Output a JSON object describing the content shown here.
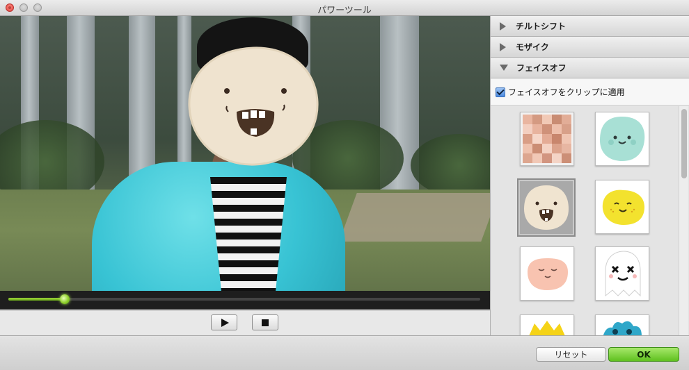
{
  "window": {
    "title": "パワーツール"
  },
  "player": {
    "progress_percent": 12
  },
  "panel": {
    "sections": [
      {
        "label": "チルトシフト",
        "expanded": false
      },
      {
        "label": "モザイク",
        "expanded": false
      },
      {
        "label": "フェイスオフ",
        "expanded": true
      }
    ],
    "faceoff": {
      "apply_label": "フェイスオフをクリップに適用",
      "apply_checked": true,
      "selected_index": 2,
      "thumbnails": [
        {
          "kind": "mosaic"
        },
        {
          "kind": "teal-blob-face"
        },
        {
          "kind": "cream-grin-face"
        },
        {
          "kind": "yellow-blob-face"
        },
        {
          "kind": "pink-sleepy-face"
        },
        {
          "kind": "ghost-face"
        },
        {
          "kind": "yellow-spiky-face"
        },
        {
          "kind": "blue-fluffy-face"
        }
      ]
    }
  },
  "footer": {
    "reset_label": "リセット",
    "ok_label": "OK"
  },
  "colors": {
    "accent_green": "#6ac11f",
    "title_red": "#e0443e",
    "panel_bg": "#f4f4f4"
  }
}
